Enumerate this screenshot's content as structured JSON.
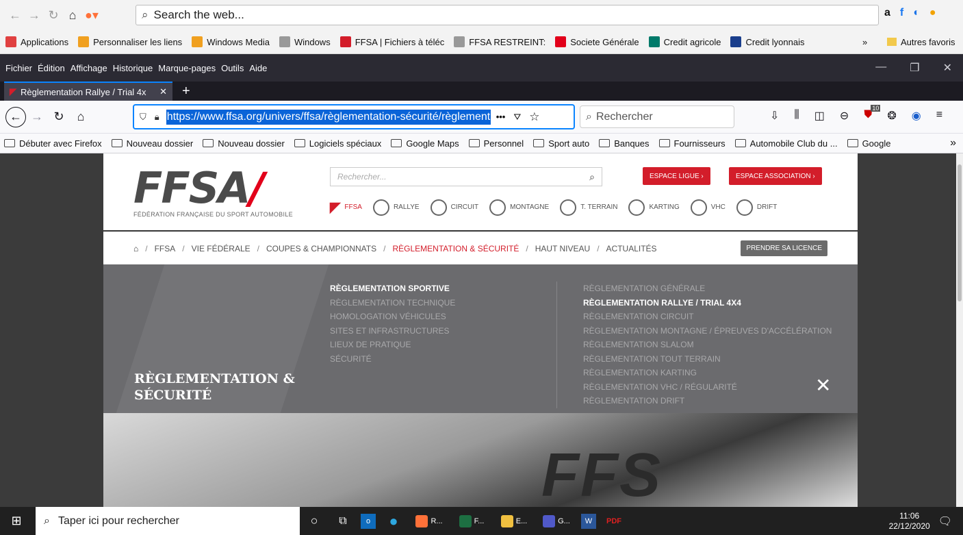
{
  "outer_browser": {
    "search_placeholder": "Search the web...",
    "bookmarks": [
      {
        "label": "Applications",
        "color": "#e04040"
      },
      {
        "label": "Personnaliser les liens",
        "color": "#f0a020"
      },
      {
        "label": "Windows Media",
        "color": "#f0a020"
      },
      {
        "label": "Windows",
        "color": "#999999"
      },
      {
        "label": "FFSA | Fichiers à téléc",
        "color": "#d31d2a"
      },
      {
        "label": "FFSA RESTREINT:",
        "color": "#999999"
      },
      {
        "label": "Societe Générale",
        "color": "#e2001a"
      },
      {
        "label": "Credit agricole",
        "color": "#007a6a"
      },
      {
        "label": "Credit lyonnais",
        "color": "#1a3e8c"
      }
    ],
    "more": "»",
    "other_bookmarks": "Autres favoris"
  },
  "firefox": {
    "menu": [
      "Fichier",
      "Édition",
      "Affichage",
      "Historique",
      "Marque-pages",
      "Outils",
      "Aide"
    ],
    "tab_title": "Règlementation Rallye / Trial 4x",
    "url": "https://www.ffsa.org/univers/ffsa/règlementation-sécurité/règlementat",
    "search_placeholder": "Rechercher",
    "notif_count": "10",
    "bookmarks": [
      "Débuter avec Firefox",
      "Nouveau dossier",
      "Nouveau dossier",
      "Logiciels spéciaux",
      "Google Maps",
      "Personnel",
      "Sport auto",
      "Banques",
      "Fournisseurs",
      "Automobile Club du ...",
      "Google"
    ],
    "more": "»"
  },
  "site": {
    "logo_text": "FFSA",
    "logo_sub": "FÉDÉRATION FRANÇAISE DU SPORT AUTOMOBILE",
    "search_placeholder": "Rechercher...",
    "btn_ligue": "ESPACE LIGUE  ›",
    "btn_asso": "ESPACE ASSOCIATION  ›",
    "universes": [
      "FFSA",
      "RALLYE",
      "CIRCUIT",
      "MONTAGNE",
      "T. TERRAIN",
      "KARTING",
      "VHC",
      "DRIFT"
    ],
    "nav": [
      "FFSA",
      "VIE FÉDÉRALE",
      "COUPES & CHAMPIONNATS",
      "RÈGLEMENTATION & SÉCURITÉ",
      "HAUT NIVEAU",
      "ACTUALITÉS"
    ],
    "licence_btn": "PRENDRE SA LICENCE",
    "section_title_1": "RÈGLEMENTATION &",
    "section_title_2": "SÉCURITÉ",
    "col1": [
      "RÈGLEMENTATION SPORTIVE",
      "RÈGLEMENTATION TECHNIQUE",
      "HOMOLOGATION VÉHICULES",
      "SITES ET INFRASTRUCTURES",
      "LIEUX DE PRATIQUE",
      "SÉCURITÉ"
    ],
    "col2": [
      "RÈGLEMENTATION GÉNÉRALE",
      "RÈGLEMENTATION RALLYE / TRIAL 4X4",
      "RÈGLEMENTATION CIRCUIT",
      "RÈGLEMENTATION MONTAGNE / ÉPREUVES D'ACCÉLÉRATION",
      "RÈGLEMENTATION SLALOM",
      "RÈGLEMENTATION TOUT TERRAIN",
      "RÈGLEMENTATION KARTING",
      "RÈGLEMENTATION VHC / RÉGULARITÉ",
      "RÈGLEMENTATION DRIFT"
    ],
    "hero_text": "FFS"
  },
  "taskbar": {
    "search_placeholder": "Taper ici pour rechercher",
    "apps": [
      {
        "label": "R...",
        "color": "#ff7139"
      },
      {
        "label": "F...",
        "color": "#1d6f42"
      },
      {
        "label": "E...",
        "color": "#f0c040"
      },
      {
        "label": "G...",
        "color": "#5059c9"
      }
    ],
    "time": "11:06",
    "date": "22/12/2020"
  }
}
